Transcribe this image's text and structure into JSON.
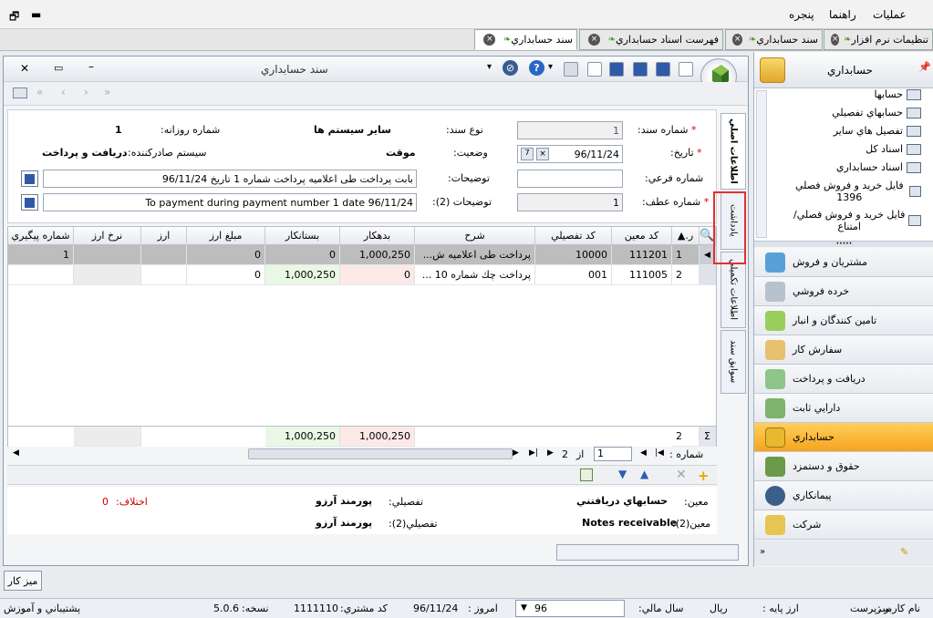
{
  "menu": {
    "items": [
      "عمليات",
      "راهنما",
      "پنجره"
    ]
  },
  "tabs": [
    {
      "label": "تنظيمات نرم افزار"
    },
    {
      "label": "سند حسابداري"
    },
    {
      "label": "فهرست اسناد حسابداري"
    },
    {
      "label": "سند حسابداري"
    }
  ],
  "window": {
    "title": "سند حسابداري"
  },
  "form": {
    "doc_no_label": "شماره سند:",
    "doc_no": "1",
    "doc_type_label": "نوع سند:",
    "doc_type": "ساير سيستم ها",
    "daily_no_label": "شماره روزانه:",
    "daily_no": "1",
    "date_label": "تاريخ:",
    "date": "96/11/24",
    "status_label": "وضعيت:",
    "status": "موقت",
    "issuer_label": "سيستم صادرکننده:",
    "issuer": "دريافت و پرداخت",
    "sub_no_label": "شماره فرعي:",
    "desc_label": "توضيحات:",
    "desc": "بابت پرداخت طی اعلاميه پرداخت شماره 1 تاريخ 96/11/24",
    "ref_no_label": "شماره عطف:",
    "ref_no": "1",
    "desc2_label": "توضيحات (2):",
    "desc2": "To payment during payment number 1 date 96/11/24"
  },
  "grid": {
    "headers": [
      "ر.",
      "کد معين",
      "کد تفصيلي",
      "شرح",
      "بدهکار",
      "بستانکار",
      "مبلغ ارز",
      "ارز",
      "نرخ ارز",
      "شماره پيگيري"
    ],
    "rows": [
      {
        "r": "1",
        "moein": "111201",
        "tafsili": "10000",
        "sharh": "پرداخت طی اعلاميه ش...",
        "bed": "1,000,250",
        "bes": "0",
        "arz_amount": "0",
        "arz": "",
        "rate": "",
        "track": "1"
      },
      {
        "r": "2",
        "moein": "111005",
        "tafsili": "001",
        "sharh": "پرداخت چك شماره 10 ...",
        "bed": "0",
        "bes": "1,000,250",
        "arz_amount": "0",
        "arz": "",
        "rate": "",
        "track": ""
      }
    ],
    "footer": {
      "count": "2",
      "bed_total": "1,000,250",
      "bes_total": "1,000,250"
    },
    "pager": {
      "label": "شماره :",
      "current": "1",
      "of": "از",
      "total": "2"
    }
  },
  "vtabs": [
    "اطلاعات اصلي",
    "يادداشت",
    "اطلاعات تکميلي",
    "سوابق سند"
  ],
  "bottom": {
    "moein_label": "معين:",
    "moein": "حسابهاي دريافتني",
    "tafsili_label": "تفصيلي:",
    "tafsili": "پورمند آرزو",
    "diff_label": "اختلاف:",
    "diff": "0",
    "moein2_label": "معين(2):",
    "moein2": "Notes receivable",
    "tafsili2_label": "تفصيلي(2):",
    "tafsili2": "پورمند آرزو"
  },
  "right": {
    "title": "حسابداري",
    "tree": [
      "حسابها",
      "حسابهاي تفصيلي",
      "تفصيل هاي ساير",
      "اسناد کل",
      "اسناد حسابداري",
      "فايل خريد و فروش فصلي 1396",
      "فايل خريد و فروش فصلي/امتناع"
    ],
    "nav": [
      "مشتريان و فروش",
      "خرده فروشي",
      "تامين کنندگان و انبار",
      "سفارش کار",
      "دريافت و پرداخت",
      "دارايي ثابت",
      "حسابداري",
      "حقوق و دستمزد",
      "پيمانکاري",
      "شرکت"
    ],
    "selected_index": 6
  },
  "taskbar": {
    "button": "ميز کار"
  },
  "status": {
    "user_label": "نام کاربر :",
    "user": "سرپرست",
    "base_currency_label": "ارز پايه :",
    "base_currency": "ريال",
    "fiscal_year_label": "سال مالي:",
    "fiscal_year": "96",
    "today_label": "امروز :",
    "today": "96/11/24",
    "customer_code_label": "کد مشتري:",
    "customer_code": "1111110",
    "version_label": "نسخه:",
    "version": "5.0.6",
    "support": "پشتيباني و آموزش"
  },
  "colors": {
    "accent": "#f6a320",
    "highlight_box": "#e03030",
    "debit_bg": "#fde8e8",
    "credit_bg": "#e8f8e4"
  }
}
